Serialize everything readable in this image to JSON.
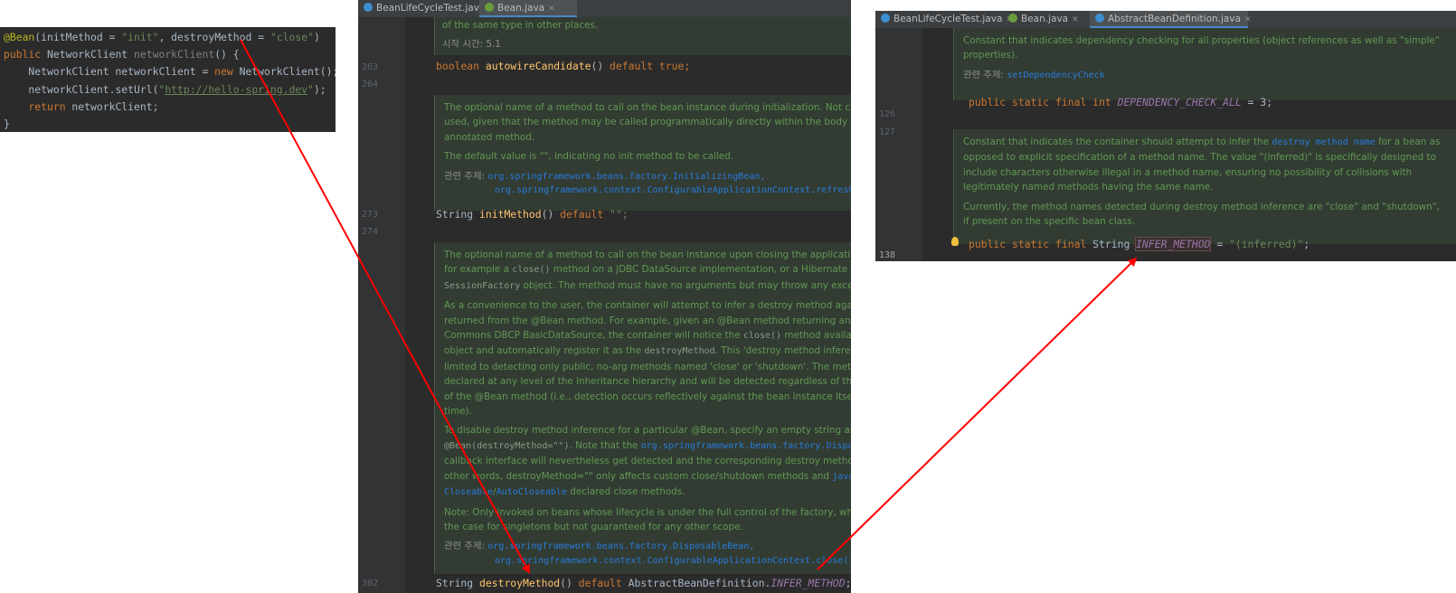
{
  "panel1": {
    "line1": {
      "ann": "@Bean",
      "open": "(initMethod = ",
      "s1": "\"init\"",
      "mid": ", destroyMethod = ",
      "s2": "\"close\"",
      "close": ")"
    },
    "line2": {
      "kw": "public",
      "type": " NetworkClient ",
      "fn": "networkClient",
      "rest": "() {"
    },
    "line3": {
      "pre": "    NetworkClient networkClient = ",
      "kw": "new",
      "rest": " NetworkClient();"
    },
    "line4": {
      "pre": "    networkClient.setUrl(",
      "q1": "\"",
      "url": "http://hello-spring.dev",
      "q2": "\"",
      "rest": ");"
    },
    "line5": {
      "kw": "    return",
      "rest": " networkClient;"
    },
    "line6": "}"
  },
  "panel2": {
    "tabs": [
      {
        "label": "BeanLifeCycleTest.java",
        "active": false
      },
      {
        "label": "Bean.java",
        "active": true
      }
    ],
    "lines": {
      "l263": "263",
      "l264": "264",
      "l273": "273",
      "l274": "274",
      "l302": "302"
    },
    "doc_top": {
      "text": "of the same type in other places.",
      "since_label": "시작 시간:",
      "since_value": "5.1"
    },
    "code263": {
      "kw": "boolean",
      "fn": "autowireCandidate",
      "rest": "() ",
      "def": "default",
      "val": " true;"
    },
    "doc_init": {
      "p1": "The optional name of a method to call on the bean instance during initialization. Not c",
      "p2": "used, given that the method may be called programmatically directly within the body o",
      "p3": "annotated method.",
      "p4": "The default value is \"\", indicating no init method to be called.",
      "see_label": "관련 주제:",
      "see1": "org.springframework.beans.factory.InitializingBean,",
      "see2": "org.springframework.context.ConfigurableApplicationContext.refresh"
    },
    "code273": {
      "type": "String ",
      "fn": "initMethod",
      "rest": "() ",
      "def": "default",
      "val": " \"\";"
    },
    "doc_destroy": {
      "a1": "The optional name of a method to call on the bean instance upon closing the applicati",
      "a2a": "for example a ",
      "a2c": "close()",
      "a2b": " method on a JDBC DataSource implementation, or a Hibernate",
      "a3c": "SessionFactory",
      "a3b": " object. The method must have no arguments but may throw any exce",
      "b1": "As a convenience to the user, the container will attempt to infer a destroy method aga",
      "b2": "returned from the @Bean method. For example, given an @Bean method returning an A",
      "b3a": "Commons DBCP BasicDataSource, the container will notice the ",
      "b3c": "close()",
      "b3b": " method availa",
      "b4a": "object and automatically register it as the ",
      "b4c": "destroyMethod",
      "b4b": ". This 'destroy method inferen",
      "b5": "limited to detecting only public, no-arg methods named 'close' or 'shutdown'. The met",
      "b6": "declared at any level of the inheritance hierarchy and will be detected regardless of the",
      "b7": "of the @Bean method (i.e., detection occurs reflectively against the bean instance itself a",
      "b8": "time).",
      "c1a": "To disable destroy method inference for a particular @Bean, specify an empty string as",
      "c2c": "@Bean(destroyMethod=\"\")",
      "c2a": ". Note that the ",
      "c2l": "org.springframework.beans.factory.Dispo",
      "c3": "callback interface will nevertheless get detected and the corresponding destroy method",
      "c4a": "other words, destroyMethod=\"\" only affects custom close/shutdown methods and ",
      "c4l": "java",
      "c5l": "Closeable",
      "c5s": "/",
      "c5l2": "AutoCloseable",
      "c5b": " declared close methods.",
      "d1": "Note: Only invoked on beans whose lifecycle is under the full control of the factory, wh",
      "d2": "the case for singletons but not guaranteed for any other scope.",
      "see_label": "관련 주제:",
      "see1": "org.springframework.beans.factory.DisposableBean,",
      "see2": "org.springframework.context.ConfigurableApplicationContext.close()"
    },
    "code302": {
      "type": "String ",
      "fn": "destroyMethod",
      "rest": "() ",
      "def": "default",
      "cls": " AbstractBeanDefinition.",
      "const": "INFER_METHOD",
      "end": ";"
    }
  },
  "panel3": {
    "tabs": [
      {
        "label": "BeanLifeCycleTest.java",
        "active": false
      },
      {
        "label": "Bean.java",
        "active": false
      },
      {
        "label": "AbstractBeanDefinition.java",
        "active": true
      }
    ],
    "lines": {
      "l126": "126",
      "l127": "127",
      "l138": "138"
    },
    "doc1": {
      "p1": "Constant that indicates dependency checking for all properties (object references as well as \"simple\"",
      "p2": "properties).",
      "see_label": "관련 주제:",
      "see": "setDependencyCheck"
    },
    "code126": {
      "kw": "public static final int ",
      "const": "DEPENDENCY_CHECK_ALL",
      "rest": " = 3;"
    },
    "doc2": {
      "p1a": "Constant that indicates the container should attempt to infer the ",
      "p1l": "destroy method name",
      "p1b": " for a bean as",
      "p2": "opposed to explicit specification of a method name. The value \"(inferred)\" is specifically designed to",
      "p3": "include characters otherwise illegal in a method name, ensuring no possibility of collisions with",
      "p4": "legitimately named methods having the same name.",
      "p5": "Currently, the method names detected during destroy method inference are \"close\" and \"shutdown\",",
      "p6": "if present on the specific bean class."
    },
    "code138": {
      "kw": "public static final ",
      "type": "String ",
      "const": "INFER_METHOD",
      "eq": " = ",
      "str": "\"(inferred)\"",
      "end": ";"
    }
  },
  "colors": {
    "arrow": "#ff0000",
    "bg": "#2b2b2b",
    "doc": "#629755",
    "keyword": "#cc7832"
  }
}
